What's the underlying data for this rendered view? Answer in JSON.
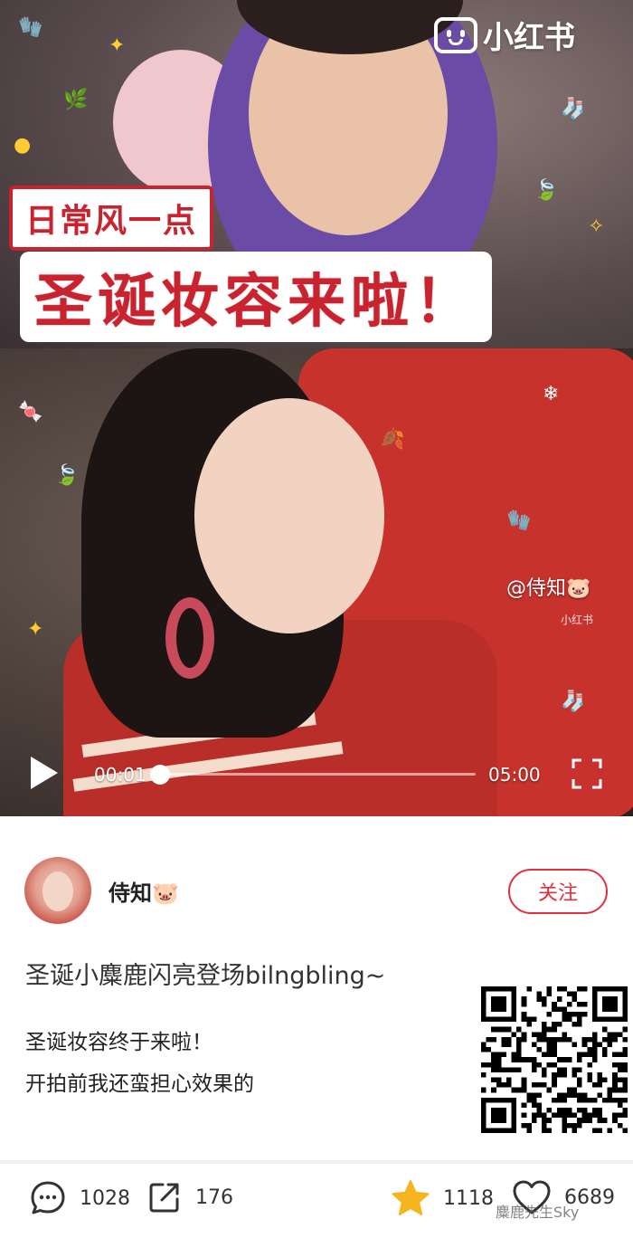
{
  "app": {
    "logo_text": "小红书"
  },
  "cover": {
    "title_line1": "日常风一点",
    "title_line2": "圣诞妆容来啦！",
    "watermark": "@侍知🐷",
    "watermark_sub": "小红书"
  },
  "player": {
    "current_time": "00:01",
    "duration": "05:00",
    "progress": 0.003
  },
  "author": {
    "name": "侍知🐷"
  },
  "follow_label": "关注",
  "post": {
    "title": "圣诞小麋鹿闪亮登场bilngbling~",
    "body_lines": [
      "圣诞妆容终于来啦！",
      "开拍前我还蛮担心效果的"
    ]
  },
  "actions": {
    "comments": "1028",
    "shares": "176",
    "collects": "1118",
    "likes": "6689"
  },
  "credit": "麋鹿先生Sky",
  "colors": {
    "accent": "#e3303f",
    "title_red": "#c8232e",
    "star": "#f6b51e"
  }
}
